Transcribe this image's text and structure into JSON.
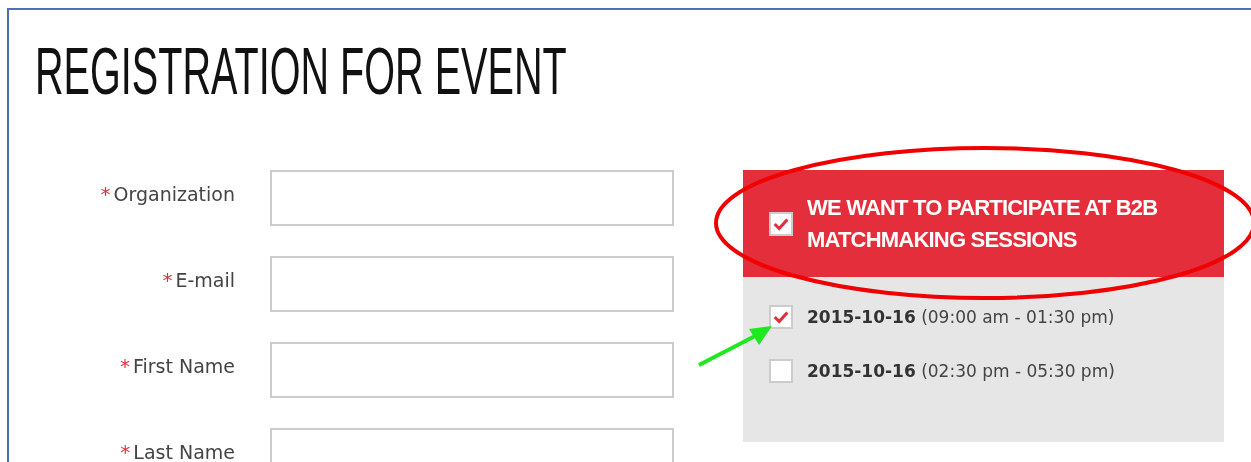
{
  "title": "REGISTRATION FOR EVENT",
  "fields": [
    {
      "label": "Organization",
      "required_mark": "*"
    },
    {
      "label": "E-mail",
      "required_mark": "*"
    },
    {
      "label": "First Name",
      "required_mark": "*"
    },
    {
      "label": "Last Name",
      "required_mark": "*"
    }
  ],
  "b2b": {
    "label": "WE WANT TO PARTICIPATE AT B2B MATCHMAKING SESSIONS",
    "checked": true
  },
  "sessions": [
    {
      "text": "**2015-10-16** (09:00 am - 01:30 pm)",
      "checked": true
    },
    {
      "text": "**2015-10-16** (02:30 pm - 05:30 pm)",
      "checked": false
    }
  ]
}
